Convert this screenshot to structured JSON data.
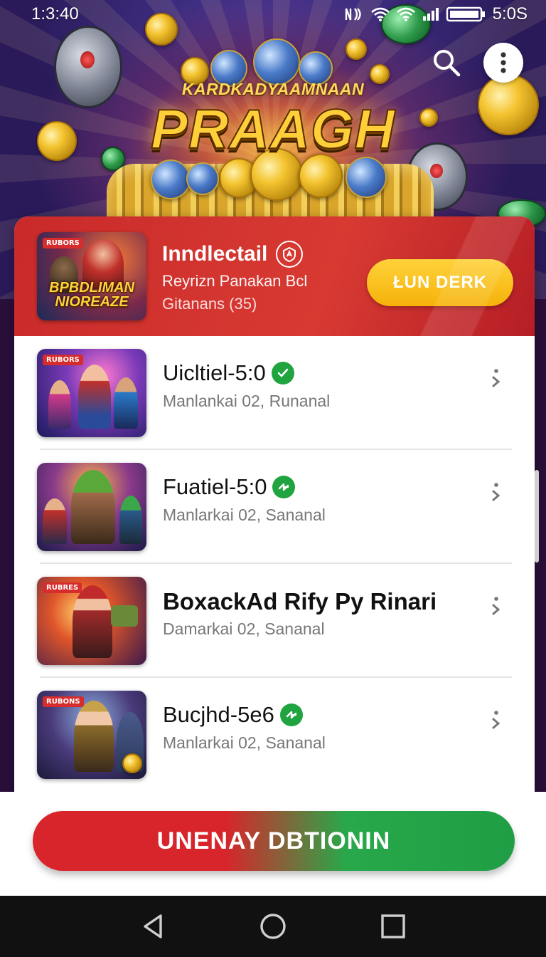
{
  "status_bar": {
    "time_left": "1:3:40",
    "time_right": "5:0S"
  },
  "hero": {
    "logo_small": "KARDKADYAAMNAAN",
    "logo_big": "PRAAGH"
  },
  "featured": {
    "thumb_tag": "RUBORS",
    "thumb_caption_line1": "BPBDLIMAN",
    "thumb_caption_line2": "NIOREAZE",
    "title": "Inndlectail",
    "subtitle": "Reyrizn Panakan Bcl",
    "meta": "Gitanans (35)",
    "cta_label": "ŁUN DERK"
  },
  "list": [
    {
      "tag": "RUBORS",
      "title": "Uicltiel-5:0",
      "subtitle": "Manlankai  02, Runanal",
      "badge": "check"
    },
    {
      "tag": "",
      "title": "Fuatiel-5:0",
      "subtitle": "Manlarkai  02, Sananal",
      "badge": "arrows"
    },
    {
      "tag": "RUBRES",
      "title": "BoxackAd Rify Py Rinari",
      "subtitle": "Damarkai  02, Sananal",
      "badge": ""
    },
    {
      "tag": "RUBONS",
      "title": "Bucjhd-5e6",
      "subtitle": "Manlarkai  02, Sananal",
      "badge": "arrows"
    }
  ],
  "primary_cta": {
    "label": "UNENAY DBTIONIN"
  },
  "colors": {
    "accent_red": "#d62c2c",
    "accent_green": "#1fa43f",
    "accent_yellow": "#f5b20a"
  },
  "icons": {
    "search": "search-icon",
    "more": "more-vertical-icon",
    "row_more": "chevron-more-icon",
    "back": "back-triangle-icon",
    "home": "home-circle-icon",
    "recents": "recents-square-icon"
  }
}
